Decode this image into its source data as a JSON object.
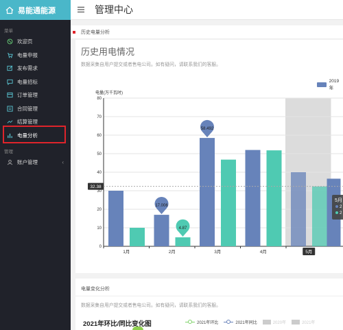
{
  "brand": {
    "title": "易能通能源"
  },
  "sidebar": {
    "section_menu": "菜单",
    "items": [
      {
        "label": "欢迎页",
        "icon": "welcome-icon"
      },
      {
        "label": "电量申报",
        "icon": "cart-icon"
      },
      {
        "label": "发布需求",
        "icon": "edit-icon"
      },
      {
        "label": "电量招标",
        "icon": "chat-icon"
      },
      {
        "label": "订单管理",
        "icon": "order-icon"
      },
      {
        "label": "合同管理",
        "icon": "contract-icon"
      },
      {
        "label": "结算管理",
        "icon": "trend-icon"
      },
      {
        "label": "电量分析",
        "icon": "bar-chart-icon"
      }
    ],
    "section_manage": "管理",
    "manage_items": [
      {
        "label": "账户管理",
        "icon": "account-icon"
      }
    ]
  },
  "header": {
    "title": "管理中心"
  },
  "tab": {
    "label": "历史电量分析"
  },
  "panel": {
    "title": "历史用电情况",
    "desc": "数据采集自用户提交或者售电公司。如有疑问，请联系我们的客服。"
  },
  "chart_data": {
    "type": "bar",
    "categories": [
      "1月",
      "2月",
      "3月",
      "4月",
      "5月"
    ],
    "ylabel": "电量(万千瓦时)",
    "ylim": [
      0,
      80
    ],
    "yticks": [
      0,
      10,
      20,
      30,
      40,
      50,
      60,
      70,
      80
    ],
    "series": [
      {
        "name": "2019年",
        "color": "#6783ba",
        "values": [
          30,
          17.006,
          58.492,
          52,
          40
        ]
      },
      {
        "name": "",
        "color": "#4fcab2",
        "values": [
          10,
          4.87,
          46.8,
          51.8,
          32.3
        ]
      }
    ],
    "markpoints": [
      {
        "series": 0,
        "index": 1,
        "label": "17.006"
      },
      {
        "series": 0,
        "index": 2,
        "label": "58.492"
      },
      {
        "series": 1,
        "index": 1,
        "label": "4.87"
      }
    ],
    "axis_pointer": {
      "y_label": "32.38",
      "x_label": "5月"
    },
    "partial_series_text": "5月",
    "partial_visible_rows": [
      "2",
      "2"
    ]
  },
  "panel2": {
    "title": "电量变化分析",
    "desc": "数据采集自用户提交或者售电公司。如有疑问，请联系我们的客服。",
    "chart_title": "2021年环比/同比变化图",
    "legend": [
      {
        "name": "2021年环比",
        "color": "#7fd36a",
        "type": "line"
      },
      {
        "name": "2021年同比",
        "color": "#6783ba",
        "type": "line"
      },
      {
        "name": "2020年",
        "color": "#cccccc",
        "type": "box"
      },
      {
        "name": "2021年",
        "color": "#cccccc",
        "type": "box"
      }
    ]
  }
}
